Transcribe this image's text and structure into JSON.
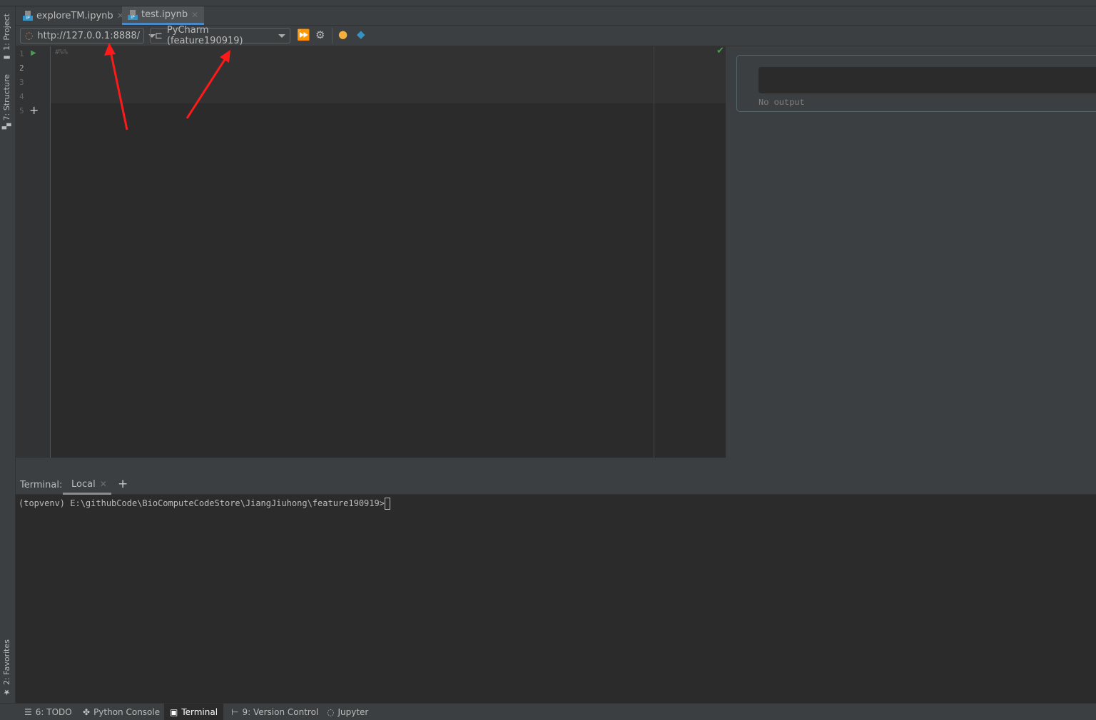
{
  "sidebar": {
    "project": "1: Project",
    "structure": "7: Structure",
    "favorites": "2: Favorites"
  },
  "tabs": [
    {
      "label": "exploreTM.ipynb",
      "active": false
    },
    {
      "label": "test.ipynb",
      "active": true
    }
  ],
  "toolbar": {
    "server_url": "http://127.0.0.1:8888/",
    "kernel": "PyCharm (feature190919)"
  },
  "editor": {
    "line_numbers": [
      "1",
      "2",
      "3",
      "4",
      "5"
    ],
    "code_first_line": "#%%",
    "output_text": "No output"
  },
  "terminal": {
    "label": "Terminal:",
    "tab": "Local",
    "prompt": "(topvenv) E:\\githubCode\\BioComputeCodeStore\\JiangJiuhong\\feature190919>"
  },
  "statusbar": {
    "items": [
      "6: TODO",
      "Python Console",
      "Terminal",
      "9: Version Control",
      "Jupyter"
    ],
    "active": "Terminal"
  },
  "colors": {
    "accent": "#4a88c7",
    "run": "#499c54",
    "annotation_arrow": "#ff1a1a"
  }
}
